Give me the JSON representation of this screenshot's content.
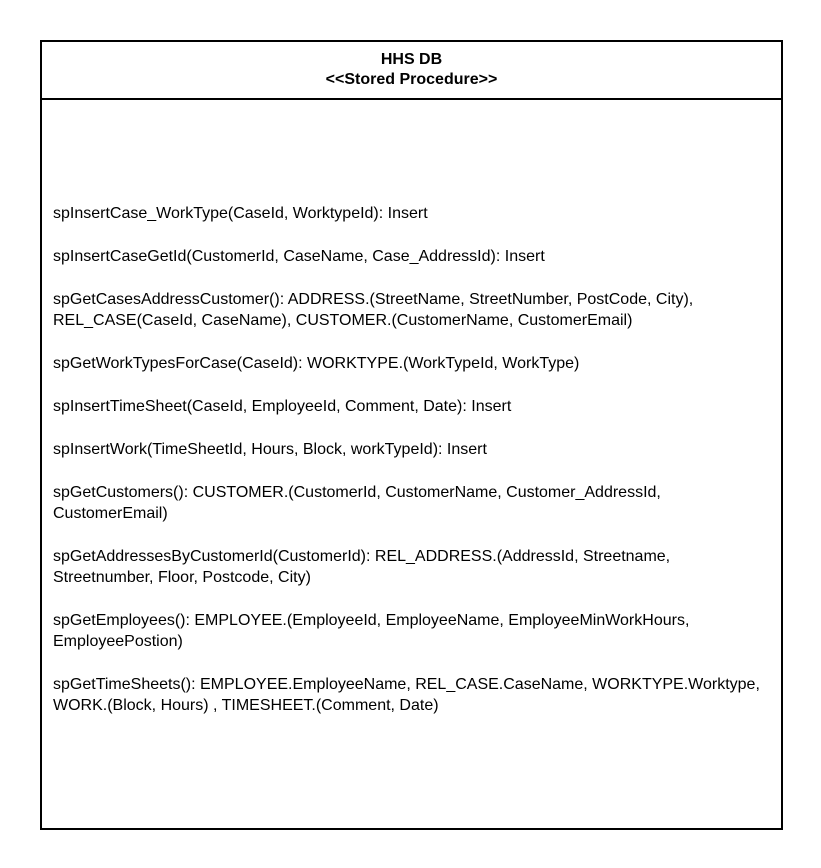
{
  "box": {
    "title": "HHS DB",
    "stereotype": "<<Stored Procedure>>"
  },
  "procedures": [
    "spInsertCase_WorkType(CaseId, WorktypeId): Insert",
    "spInsertCaseGetId(CustomerId, CaseName, Case_AddressId): Insert",
    "spGetCasesAddressCustomer(): ADDRESS.(StreetName, StreetNumber, PostCode, City), REL_CASE(CaseId, CaseName), CUSTOMER.(CustomerName, CustomerEmail)",
    "spGetWorkTypesForCase(CaseId): WORKTYPE.(WorkTypeId, WorkType)",
    "spInsertTimeSheet(CaseId, EmployeeId, Comment, Date): Insert",
    "spInsertWork(TimeSheetId, Hours, Block, workTypeId): Insert",
    "spGetCustomers(): CUSTOMER.(CustomerId, CustomerName, Customer_AddressId, CustomerEmail)",
    "spGetAddressesByCustomerId(CustomerId): REL_ADDRESS.(AddressId, Streetname, Streetnumber, Floor, Postcode, City)",
    "spGetEmployees(): EMPLOYEE.(EmployeeId, EmployeeName, EmployeeMinWorkHours, EmployeePostion)",
    "spGetTimeSheets(): EMPLOYEE.EmployeeName, REL_CASE.CaseName, WORKTYPE.Worktype, WORK.(Block, Hours) , TIMESHEET.(Comment, Date)"
  ]
}
